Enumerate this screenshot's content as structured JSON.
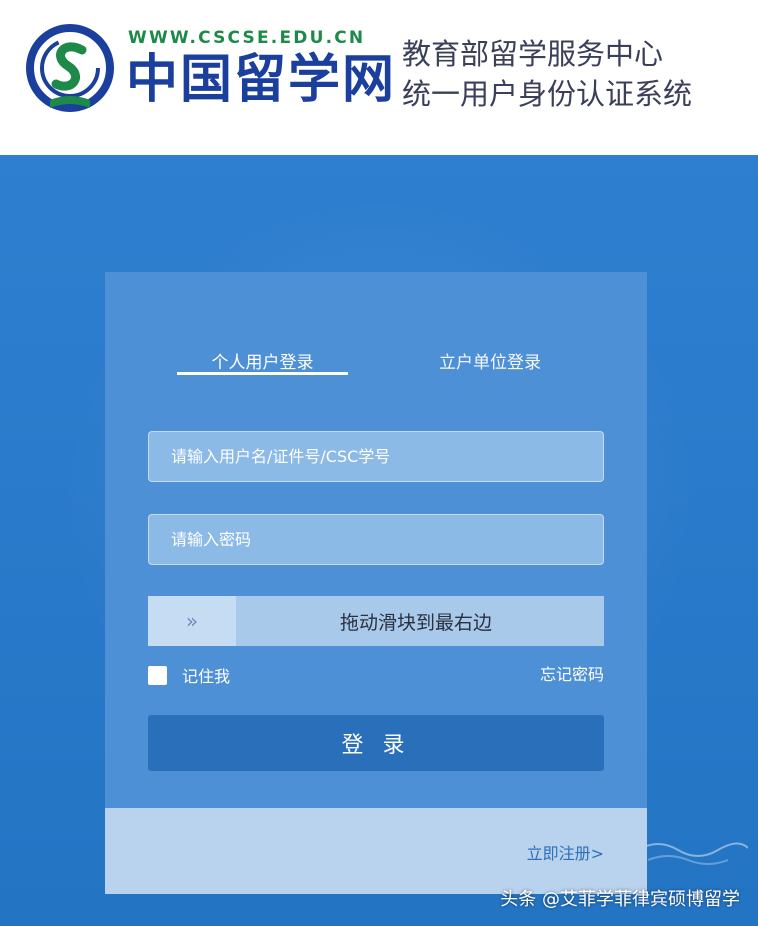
{
  "header": {
    "logo": {
      "icon": "cscse-logo-icon",
      "url_text": "WWW.CSCSE.EDU.CN",
      "name_text": "中国留学网"
    },
    "title_line1": "教育部留学服务中心",
    "title_line2": "统一用户身份认证系统"
  },
  "login": {
    "tabs": [
      {
        "label": "个人用户登录",
        "active": true
      },
      {
        "label": "立户单位登录",
        "active": false
      }
    ],
    "username": {
      "placeholder": "请输入用户名/证件号/CSC学号",
      "value": ""
    },
    "password": {
      "placeholder": "请输入密码",
      "value": ""
    },
    "slider": {
      "handle_glyph": "»",
      "text": "拖动滑块到最右边",
      "progress": 0
    },
    "remember_label": "记住我",
    "remember_checked": false,
    "forgot_label": "忘记密码",
    "login_button": "登 录",
    "register_link": "立即注册>"
  },
  "watermark": "头条 @艾菲学菲律宾硕博留学",
  "colors": {
    "background_blue": "#2b7bcc",
    "card": "#4d90d6",
    "login_button": "#2a6fb9",
    "footer": "#b9d3ee",
    "logo_blue": "#1a3f9c",
    "logo_green": "#1e8a4a"
  }
}
